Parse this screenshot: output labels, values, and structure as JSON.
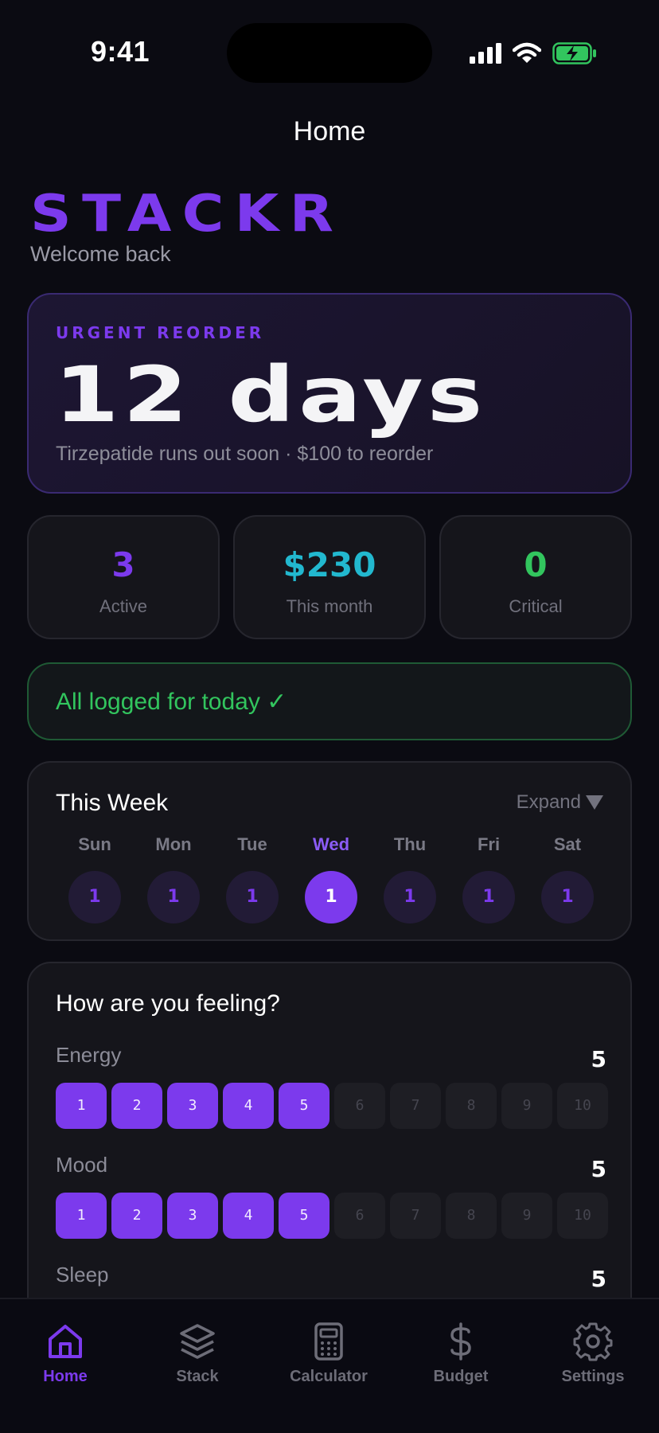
{
  "status": {
    "time": "9:41"
  },
  "nav": {
    "title": "Home"
  },
  "brand": {
    "name": "STACKR",
    "welcome": "Welcome back"
  },
  "urgent": {
    "label": "URGENT REORDER",
    "value": "12 days",
    "subtitle": "Tirzepatide runs out soon · $100 to reorder"
  },
  "stats": [
    {
      "value": "3",
      "label": "Active",
      "color": "#7c3aed"
    },
    {
      "value": "$230",
      "label": "This month",
      "color": "#22b8cf"
    },
    {
      "value": "0",
      "label": "Critical",
      "color": "#32c55e"
    }
  ],
  "logged": {
    "text": "All logged for today ✓"
  },
  "week": {
    "title": "This Week",
    "expand_label": "Expand",
    "days": [
      {
        "name": "Sun",
        "count": "1",
        "active": false
      },
      {
        "name": "Mon",
        "count": "1",
        "active": false
      },
      {
        "name": "Tue",
        "count": "1",
        "active": false
      },
      {
        "name": "Wed",
        "count": "1",
        "active": true
      },
      {
        "name": "Thu",
        "count": "1",
        "active": false
      },
      {
        "name": "Fri",
        "count": "1",
        "active": false
      },
      {
        "name": "Sat",
        "count": "1",
        "active": false
      }
    ]
  },
  "feeling": {
    "title": "How are you feeling?",
    "scale": [
      "1",
      "2",
      "3",
      "4",
      "5",
      "6",
      "7",
      "8",
      "9",
      "10"
    ],
    "metrics": [
      {
        "label": "Energy",
        "value": "5",
        "selected": 5
      },
      {
        "label": "Mood",
        "value": "5",
        "selected": 5
      },
      {
        "label": "Sleep",
        "value": "5",
        "selected": 5
      }
    ]
  },
  "tabs": [
    {
      "label": "Home",
      "icon": "home-icon",
      "active": true
    },
    {
      "label": "Stack",
      "icon": "layers-icon",
      "active": false
    },
    {
      "label": "Calculator",
      "icon": "calculator-icon",
      "active": false
    },
    {
      "label": "Budget",
      "icon": "dollar-icon",
      "active": false
    },
    {
      "label": "Settings",
      "icon": "gear-icon",
      "active": false
    }
  ],
  "colors": {
    "accent": "#7c3aed",
    "success": "#32c55e",
    "cyan": "#22b8cf",
    "background": "#0b0b12"
  }
}
